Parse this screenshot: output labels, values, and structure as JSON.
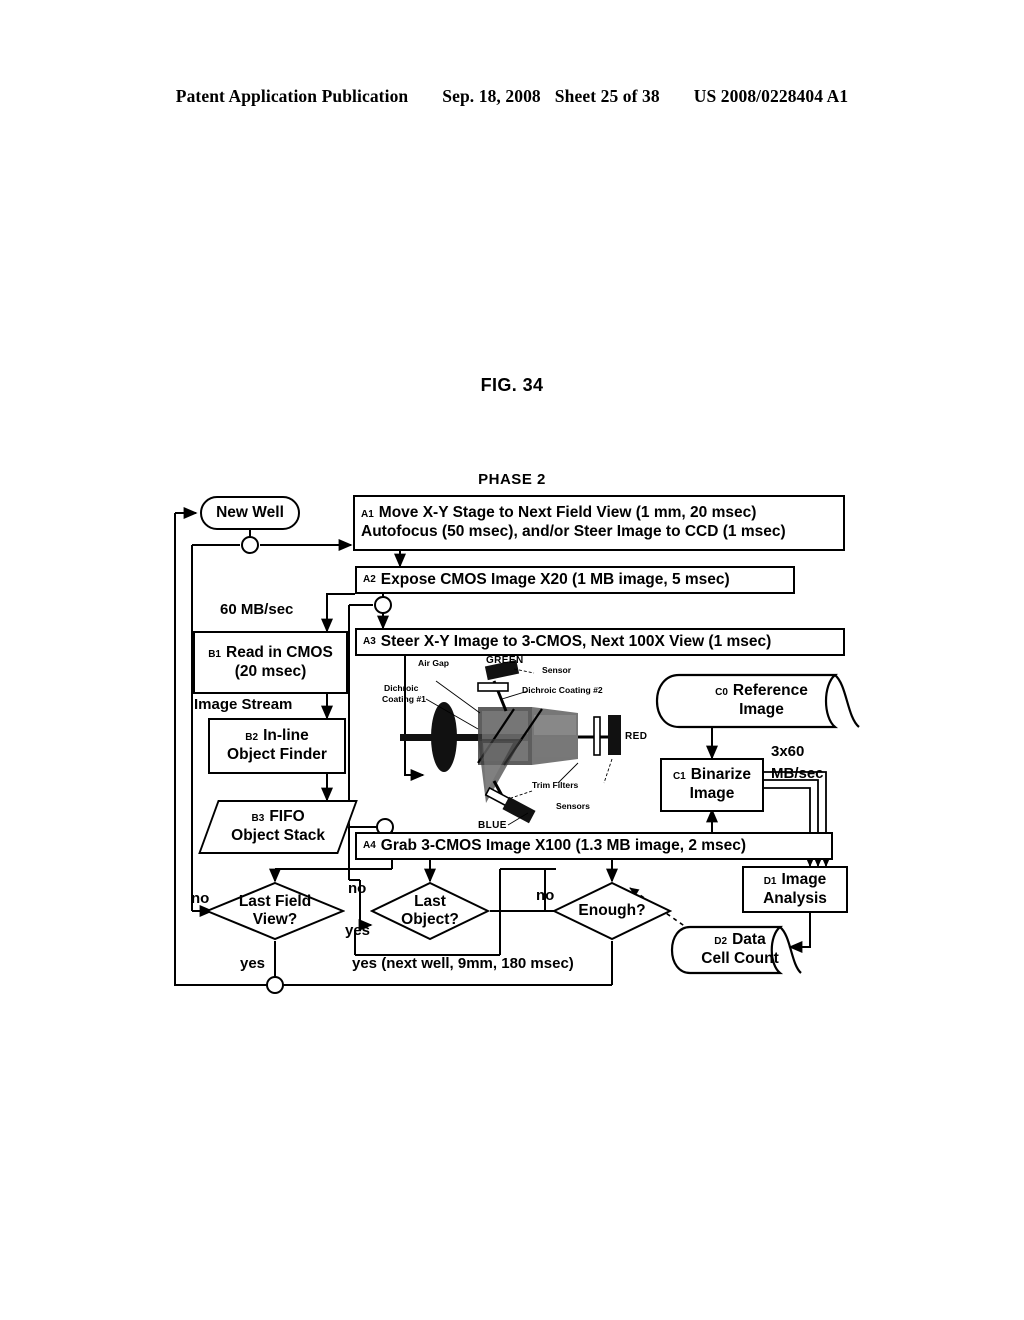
{
  "header": {
    "publication": "Patent Application Publication",
    "date": "Sep. 18, 2008",
    "sheet": "Sheet 25 of 38",
    "docnum": "US 2008/0228404 A1"
  },
  "figure": {
    "title": "FIG. 34",
    "phase": "PHASE 2"
  },
  "nodes": {
    "new_well": {
      "label": "New Well"
    },
    "a1": {
      "tag": "A1",
      "line1": "Move X-Y Stage to Next Field View (1 mm, 20 msec)",
      "line2": "Autofocus (50 msec), and/or Steer Image to CCD (1 msec)"
    },
    "a2": {
      "tag": "A2",
      "line1": "Expose CMOS Image X20 (1 MB image, 5 msec)"
    },
    "a3": {
      "tag": "A3",
      "line1": "Steer X-Y Image to 3-CMOS, Next 100X View (1 msec)"
    },
    "a4": {
      "tag": "A4",
      "line1": "Grab 3-CMOS Image X100 (1.3 MB image, 2 msec)"
    },
    "b1": {
      "tag": "B1",
      "line1": "Read in CMOS",
      "line2": "(20 msec)"
    },
    "b2": {
      "tag": "B2",
      "line1": "In-line",
      "line2": "Object Finder"
    },
    "b3": {
      "tag": "B3",
      "line1": "FIFO",
      "line2": "Object Stack"
    },
    "c0": {
      "tag": "C0",
      "line1": "Reference",
      "line2": "Image"
    },
    "c1": {
      "tag": "C1",
      "line1": "Binarize",
      "line2": "Image"
    },
    "d1": {
      "tag": "D1",
      "line1": "Image",
      "line2": "Analysis"
    },
    "d2": {
      "tag": "D2",
      "line1": "Data",
      "line2": "Cell Count"
    },
    "dec_field": {
      "line1": "Last Field",
      "line2": "View?"
    },
    "dec_object": {
      "line1": "Last",
      "line2": "Object?"
    },
    "dec_enough": {
      "line1": "Enough?"
    }
  },
  "edge_labels": {
    "rate_60": "60 MB/sec",
    "image_stream": "Image Stream",
    "rate_3x60_l1": "3x60",
    "rate_3x60_l2": "MB/sec",
    "no_field": "no",
    "yes_field": "yes",
    "no_object": "no",
    "yes_object": "yes",
    "no_enough": "no",
    "yes_next_well": "yes (next well, 9mm, 180 msec)"
  },
  "optics": {
    "air_gap": "Air Gap",
    "green": "GREEN",
    "sensor": "Sensor",
    "dichroic1_l1": "Dichroic",
    "dichroic1_l2": "Coating #1",
    "dichroic2": "Dichroic Coating #2",
    "red": "RED",
    "trim_filters": "Trim Filters",
    "sensors": "Sensors",
    "blue": "BLUE"
  },
  "colors": {
    "ink": "#000000",
    "paper": "#ffffff"
  }
}
